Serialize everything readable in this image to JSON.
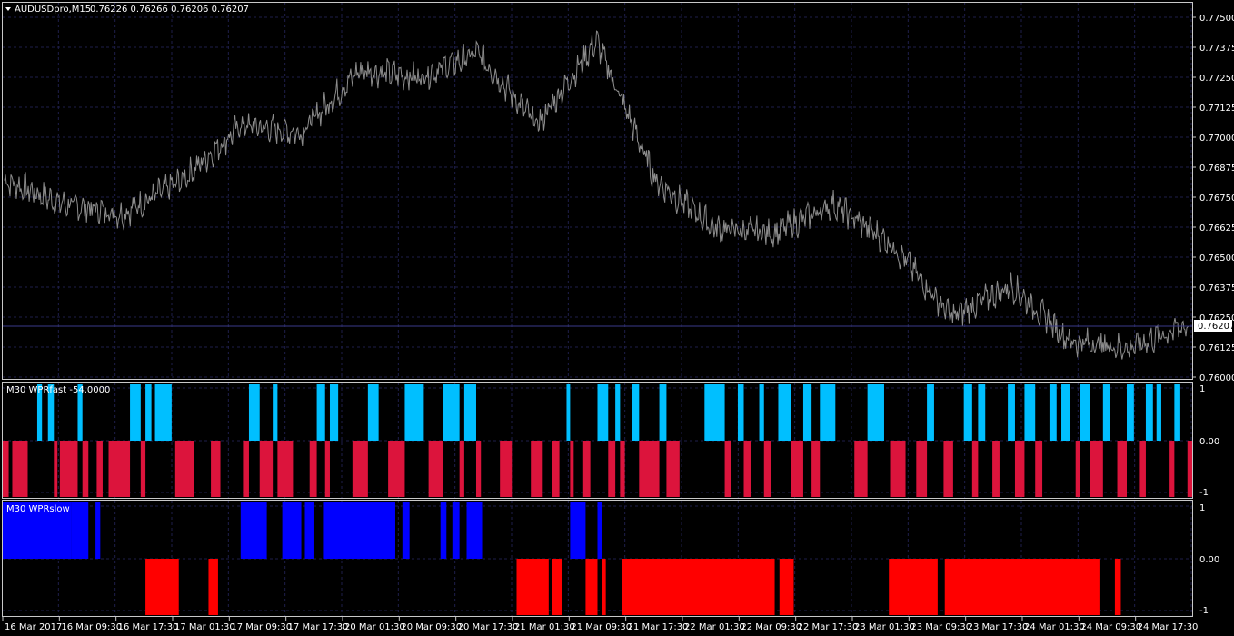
{
  "main": {
    "title": "AUDUSDpro,M15",
    "ohlc": "0.76226 0.76266 0.76206 0.76207",
    "current_price": "0.76207",
    "price_ticks": [
      "0.77500",
      "0.77375",
      "0.77250",
      "0.77125",
      "0.77000",
      "0.76875",
      "0.76750",
      "0.76625",
      "0.76500",
      "0.76375",
      "0.76250",
      "0.76125",
      "0.76000"
    ]
  },
  "fast": {
    "title": "M30 WPRfast -54.0000",
    "ticks": [
      "1",
      "0.00",
      "-1"
    ]
  },
  "slow": {
    "title": "M30 WPRslow",
    "ticks": [
      "1",
      "0.00",
      "-1"
    ]
  },
  "time_labels": [
    "16 Mar 2017",
    "16 Mar 09:30",
    "16 Mar 17:30",
    "17 Mar 01:30",
    "17 Mar 09:30",
    "17 Mar 17:30",
    "20 Mar 01:30",
    "20 Mar 09:30",
    "20 Mar 17:30",
    "21 Mar 01:30",
    "21 Mar 09:30",
    "21 Mar 17:30",
    "22 Mar 01:30",
    "22 Mar 09:30",
    "22 Mar 17:30",
    "23 Mar 01:30",
    "23 Mar 09:30",
    "23 Mar 17:30",
    "24 Mar 01:30",
    "24 Mar 09:30",
    "24 Mar 17:30"
  ],
  "colors": {
    "background": "#000000",
    "grid": "#1e1e4a",
    "price_line": "#8c8c8c",
    "bull_candle": "#00b000",
    "fast_up": "#00bfff",
    "fast_down": "#dc143c",
    "slow_up": "#0000ff",
    "slow_down": "#ff0000"
  },
  "chart_data": [
    {
      "type": "line",
      "name": "AUDUSDpro M15 close",
      "y_range": [
        0.76,
        0.775
      ],
      "x": [
        "16 Mar 2017",
        "16 Mar 09:30",
        "16 Mar 17:30",
        "17 Mar 01:30",
        "17 Mar 09:30",
        "17 Mar 17:30",
        "20 Mar 01:30",
        "20 Mar 09:30",
        "20 Mar 17:30",
        "21 Mar 01:30",
        "21 Mar 09:30",
        "21 Mar 17:30",
        "22 Mar 01:30",
        "22 Mar 09:30",
        "22 Mar 17:30",
        "23 Mar 01:30",
        "23 Mar 09:30",
        "23 Mar 17:30",
        "24 Mar 01:30",
        "24 Mar 09:30",
        "24 Mar 17:30"
      ],
      "y": [
        0.7682,
        0.7672,
        0.7668,
        0.7682,
        0.7705,
        0.7702,
        0.7728,
        0.7725,
        0.7735,
        0.7705,
        0.774,
        0.7682,
        0.7662,
        0.766,
        0.7672,
        0.7655,
        0.7625,
        0.7638,
        0.7615,
        0.7612,
        0.7622
      ]
    },
    {
      "type": "bar",
      "name": "WPRfast",
      "ylim": [
        -1,
        1
      ],
      "segments": [
        [
          0,
          0.005,
          -1
        ],
        [
          0.005,
          0.008,
          0
        ],
        [
          0.008,
          0.021,
          -1
        ],
        [
          0.021,
          0.029,
          0
        ],
        [
          0.029,
          0.033,
          1
        ],
        [
          0.033,
          0.038,
          0
        ],
        [
          0.038,
          0.043,
          1
        ],
        [
          0.043,
          0.046,
          -1
        ],
        [
          0.046,
          0.048,
          0
        ],
        [
          0.048,
          0.063,
          -1
        ],
        [
          0.063,
          0.067,
          1
        ],
        [
          0.067,
          0.072,
          -1
        ],
        [
          0.072,
          0.079,
          0
        ],
        [
          0.079,
          0.084,
          -1
        ],
        [
          0.084,
          0.089,
          0
        ],
        [
          0.089,
          0.107,
          -1
        ],
        [
          0.107,
          0.116,
          1
        ],
        [
          0.116,
          0.12,
          -1
        ],
        [
          0.12,
          0.125,
          1
        ],
        [
          0.125,
          0.128,
          0
        ],
        [
          0.128,
          0.142,
          1
        ],
        [
          0.142,
          0.145,
          0
        ],
        [
          0.145,
          0.161,
          -1
        ],
        [
          0.161,
          0.175,
          0
        ],
        [
          0.175,
          0.183,
          -1
        ],
        [
          0.183,
          0.202,
          0
        ],
        [
          0.202,
          0.207,
          -1
        ],
        [
          0.207,
          0.216,
          1
        ],
        [
          0.216,
          0.227,
          -1
        ],
        [
          0.227,
          0.231,
          1
        ],
        [
          0.231,
          0.244,
          -1
        ],
        [
          0.244,
          0.258,
          0
        ],
        [
          0.258,
          0.264,
          -1
        ],
        [
          0.264,
          0.271,
          1
        ],
        [
          0.271,
          0.275,
          -1
        ],
        [
          0.275,
          0.282,
          1
        ],
        [
          0.282,
          0.294,
          0
        ],
        [
          0.294,
          0.307,
          -1
        ],
        [
          0.307,
          0.316,
          1
        ],
        [
          0.316,
          0.324,
          0
        ],
        [
          0.324,
          0.338,
          -1
        ],
        [
          0.338,
          0.354,
          1
        ],
        [
          0.354,
          0.358,
          0
        ],
        [
          0.358,
          0.37,
          -1
        ],
        [
          0.37,
          0.384,
          1
        ],
        [
          0.384,
          0.388,
          -1
        ],
        [
          0.388,
          0.398,
          1
        ],
        [
          0.398,
          0.402,
          -1
        ],
        [
          0.402,
          0.418,
          0
        ],
        [
          0.418,
          0.428,
          -1
        ],
        [
          0.428,
          0.444,
          0
        ],
        [
          0.444,
          0.454,
          -1
        ],
        [
          0.454,
          0.462,
          0
        ],
        [
          0.462,
          0.468,
          -1
        ],
        [
          0.468,
          0.474,
          0
        ],
        [
          0.474,
          0.477,
          1
        ],
        [
          0.477,
          0.48,
          -1
        ],
        [
          0.48,
          0.488,
          0
        ],
        [
          0.488,
          0.494,
          -1
        ],
        [
          0.494,
          0.5,
          0
        ],
        [
          0.5,
          0.509,
          1
        ],
        [
          0.509,
          0.515,
          -1
        ],
        [
          0.515,
          0.519,
          1
        ],
        [
          0.519,
          0.523,
          -1
        ],
        [
          0.523,
          0.529,
          0
        ],
        [
          0.529,
          0.535,
          1
        ],
        [
          0.535,
          0.552,
          -1
        ],
        [
          0.552,
          0.558,
          1
        ],
        [
          0.558,
          0.569,
          -1
        ],
        [
          0.569,
          0.59,
          0
        ],
        [
          0.59,
          0.607,
          1
        ],
        [
          0.607,
          0.612,
          -1
        ],
        [
          0.612,
          0.618,
          0
        ],
        [
          0.618,
          0.623,
          1
        ],
        [
          0.623,
          0.629,
          -1
        ],
        [
          0.629,
          0.636,
          0
        ],
        [
          0.636,
          0.64,
          1
        ],
        [
          0.64,
          0.646,
          -1
        ],
        [
          0.646,
          0.652,
          0
        ],
        [
          0.652,
          0.663,
          1
        ],
        [
          0.663,
          0.673,
          -1
        ],
        [
          0.673,
          0.68,
          1
        ],
        [
          0.68,
          0.687,
          -1
        ],
        [
          0.687,
          0.7,
          1
        ],
        [
          0.7,
          0.716,
          0
        ],
        [
          0.716,
          0.727,
          -1
        ],
        [
          0.727,
          0.741,
          1
        ],
        [
          0.741,
          0.746,
          0
        ],
        [
          0.746,
          0.759,
          -1
        ],
        [
          0.759,
          0.768,
          0
        ],
        [
          0.768,
          0.777,
          -1
        ],
        [
          0.777,
          0.783,
          1
        ],
        [
          0.783,
          0.791,
          0
        ],
        [
          0.791,
          0.799,
          -1
        ],
        [
          0.799,
          0.808,
          0
        ],
        [
          0.808,
          0.815,
          1
        ],
        [
          0.815,
          0.82,
          -1
        ],
        [
          0.82,
          0.826,
          1
        ],
        [
          0.826,
          0.832,
          0
        ],
        [
          0.832,
          0.838,
          -1
        ],
        [
          0.838,
          0.845,
          0
        ],
        [
          0.845,
          0.851,
          1
        ],
        [
          0.851,
          0.859,
          -1
        ],
        [
          0.859,
          0.868,
          1
        ],
        [
          0.868,
          0.874,
          -1
        ],
        [
          0.874,
          0.88,
          0
        ],
        [
          0.88,
          0.886,
          1
        ],
        [
          0.886,
          0.89,
          0
        ],
        [
          0.89,
          0.897,
          1
        ],
        [
          0.897,
          0.902,
          0
        ],
        [
          0.902,
          0.906,
          -1
        ],
        [
          0.906,
          0.914,
          1
        ],
        [
          0.914,
          0.925,
          -1
        ],
        [
          0.925,
          0.931,
          1
        ],
        [
          0.931,
          0.937,
          0
        ],
        [
          0.937,
          0.945,
          -1
        ],
        [
          0.945,
          0.951,
          1
        ],
        [
          0.951,
          0.956,
          0
        ],
        [
          0.956,
          0.961,
          -1
        ],
        [
          0.961,
          0.967,
          1
        ],
        [
          0.967,
          0.97,
          0
        ],
        [
          0.97,
          0.974,
          1
        ],
        [
          0.974,
          0.981,
          0
        ],
        [
          0.981,
          0.985,
          -1
        ],
        [
          0.985,
          0.99,
          1
        ],
        [
          0.99,
          0.996,
          0
        ],
        [
          0.996,
          1.0,
          -1
        ]
      ]
    },
    {
      "type": "bar",
      "name": "WPRslow",
      "ylim": [
        -1,
        1
      ],
      "segments": [
        [
          0,
          0.058,
          1
        ],
        [
          0.058,
          0.072,
          1
        ],
        [
          0.072,
          0.078,
          0
        ],
        [
          0.078,
          0.082,
          1
        ],
        [
          0.082,
          0.12,
          0
        ],
        [
          0.12,
          0.148,
          -1
        ],
        [
          0.148,
          0.173,
          0
        ],
        [
          0.173,
          0.181,
          -1
        ],
        [
          0.181,
          0.2,
          0
        ],
        [
          0.2,
          0.222,
          1
        ],
        [
          0.222,
          0.235,
          0
        ],
        [
          0.235,
          0.251,
          1
        ],
        [
          0.251,
          0.254,
          0
        ],
        [
          0.254,
          0.262,
          1
        ],
        [
          0.262,
          0.27,
          0
        ],
        [
          0.27,
          0.33,
          1
        ],
        [
          0.33,
          0.336,
          0
        ],
        [
          0.336,
          0.342,
          1
        ],
        [
          0.342,
          0.368,
          0
        ],
        [
          0.368,
          0.373,
          1
        ],
        [
          0.373,
          0.378,
          0
        ],
        [
          0.378,
          0.384,
          1
        ],
        [
          0.384,
          0.39,
          0
        ],
        [
          0.39,
          0.403,
          1
        ],
        [
          0.403,
          0.432,
          0
        ],
        [
          0.432,
          0.459,
          -1
        ],
        [
          0.459,
          0.462,
          0
        ],
        [
          0.462,
          0.47,
          -1
        ],
        [
          0.47,
          0.477,
          0
        ],
        [
          0.477,
          0.49,
          1
        ],
        [
          0.49,
          0.5,
          -1
        ],
        [
          0.5,
          0.504,
          1
        ],
        [
          0.504,
          0.507,
          -1
        ],
        [
          0.507,
          0.521,
          0
        ],
        [
          0.521,
          0.649,
          -1
        ],
        [
          0.649,
          0.653,
          0
        ],
        [
          0.653,
          0.665,
          -1
        ],
        [
          0.665,
          0.745,
          0
        ],
        [
          0.745,
          0.786,
          -1
        ],
        [
          0.786,
          0.792,
          0
        ],
        [
          0.792,
          0.922,
          -1
        ],
        [
          0.922,
          0.935,
          0
        ],
        [
          0.935,
          0.94,
          -1
        ],
        [
          0.94,
          1.0,
          0
        ]
      ]
    }
  ]
}
